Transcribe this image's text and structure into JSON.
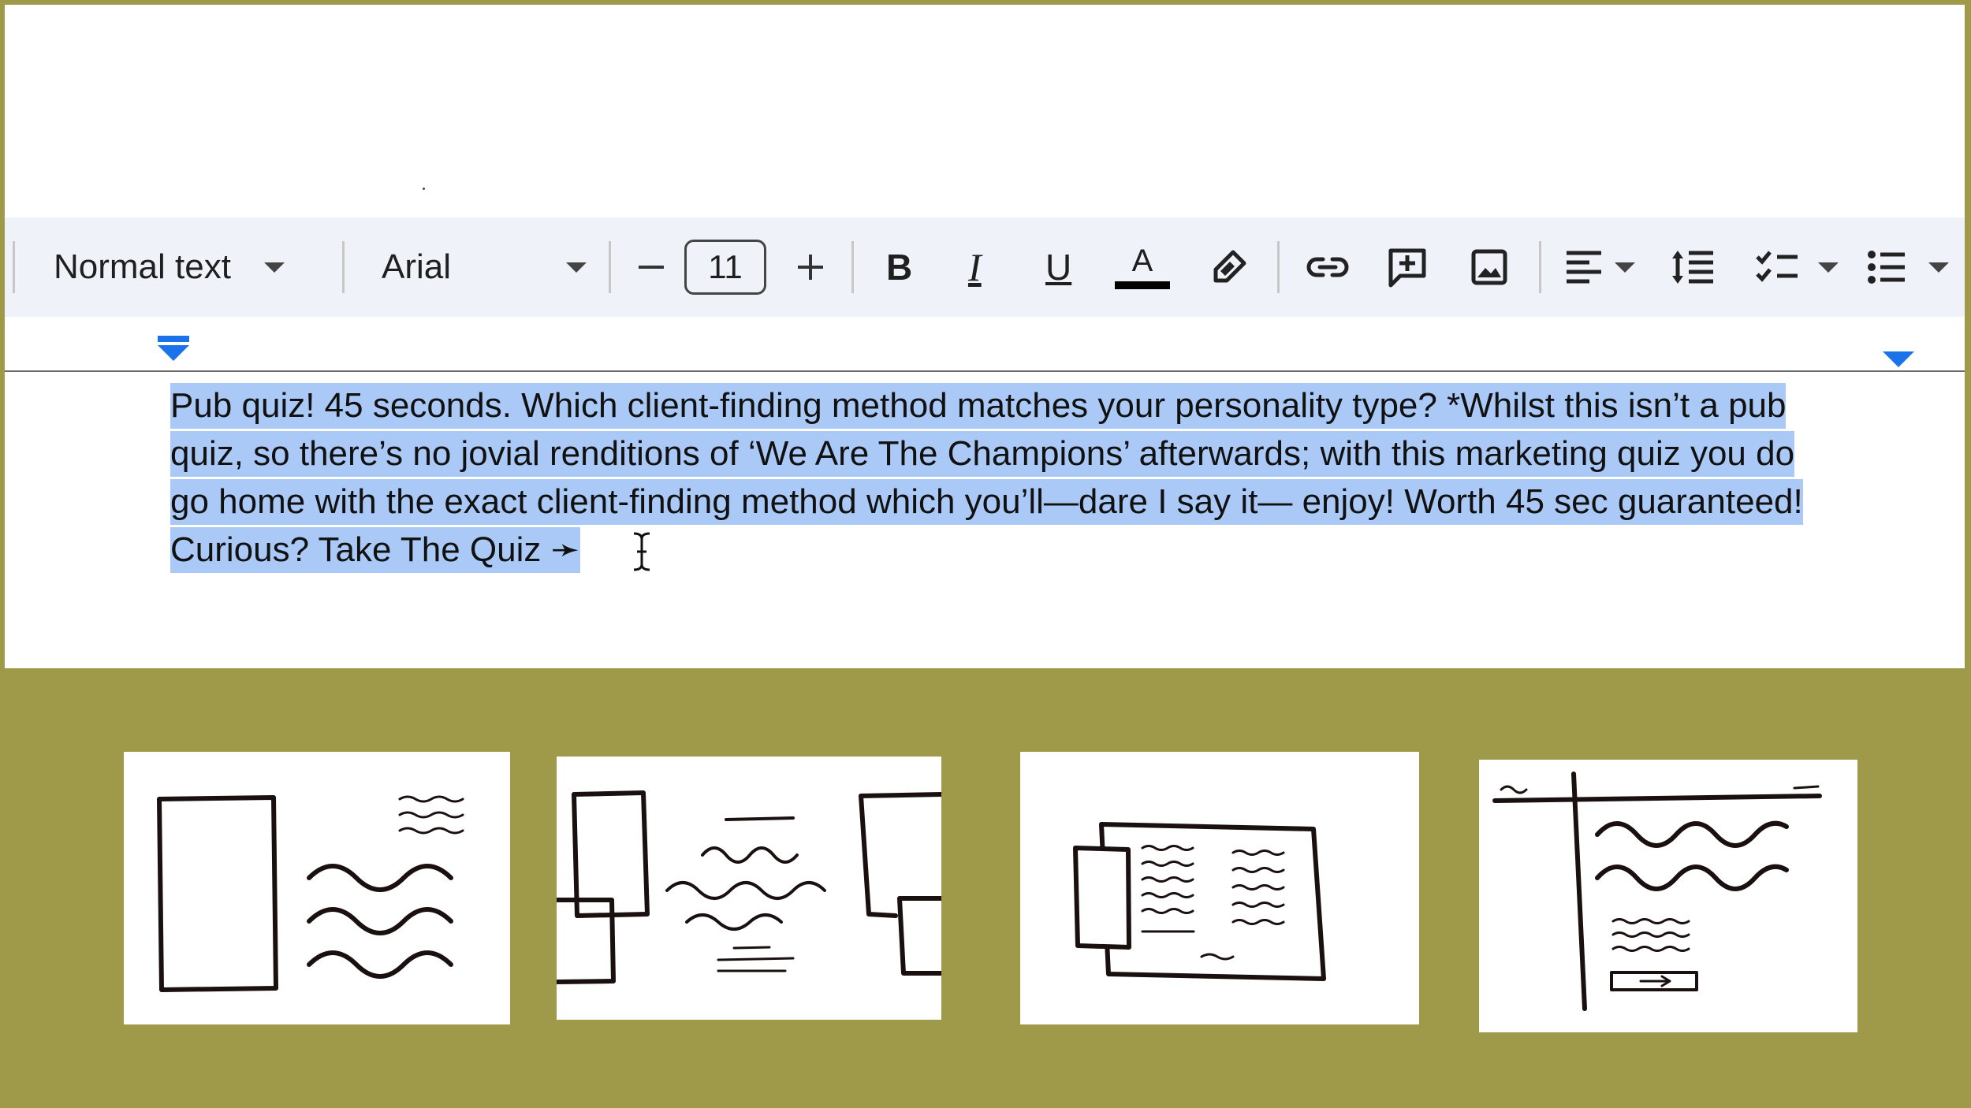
{
  "toolbar": {
    "style": "Normal text",
    "font": "Arial",
    "font_size": "11",
    "decrease": "−",
    "increase": "+",
    "bold": "B",
    "italic": "I",
    "underline": "U",
    "text_color": "A",
    "icons": [
      "highlight-pen-icon",
      "link-icon",
      "add-comment-icon",
      "insert-image-icon",
      "align-left-icon",
      "line-spacing-icon",
      "checklist-icon",
      "bulleted-list-icon"
    ]
  },
  "document": {
    "lines": [
      "Pub quiz! 45 seconds. Which client-finding method matches your personality type? *Whilst this isn’t a pub",
      "quiz, so there’s no jovial renditions of ‘We Are The Champions’ afterwards; with this marketing quiz you do",
      "go home with the exact client-finding method which you’ll—dare I say it— enjoy! Worth 45 sec guaranteed!",
      "Curious? Take The Quiz ➛ "
    ],
    "selection_color": "#aac9f6"
  },
  "colors": {
    "background": "#9e9a49",
    "toolbar": "#eff3f9",
    "accent": "#1a73e8"
  },
  "thumbnails": [
    "layout-sketch-1",
    "layout-sketch-2",
    "layout-sketch-3",
    "layout-sketch-4"
  ]
}
